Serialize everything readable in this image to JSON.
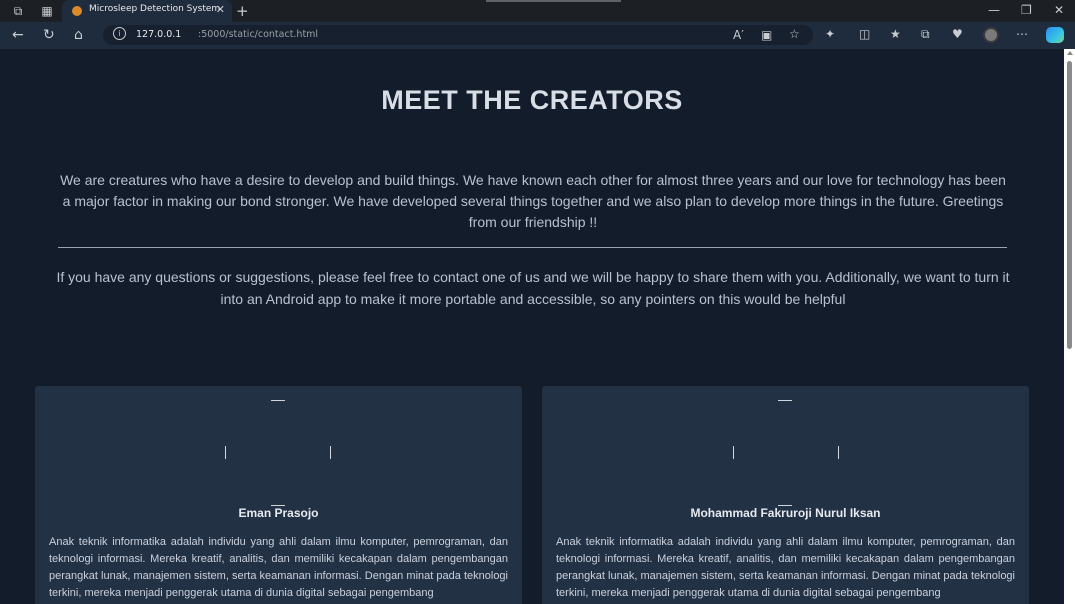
{
  "browser": {
    "tab_title": "Microsleep Detection System",
    "url_host": "127.0.0.1",
    "url_path": ":5000/static/contact.html"
  },
  "page": {
    "title": "MEET THE CREATORS",
    "intro": "We are creatures who have a desire to develop and build things. We have known each other for almost three years and our love for technology has been a major factor in making our bond stronger. We have developed several things together and we also plan to develop more things in the future. Greetings from our friendship !!",
    "contact_text": "If you have any questions or suggestions, please feel free to contact one of us and we will be happy to share them with you. Additionally, we want to turn it into an Android app to make it more portable and accessible, so any pointers on this would be helpful"
  },
  "creators": [
    {
      "name": "Eman Prasojo",
      "bio": "Anak teknik informatika adalah individu yang ahli dalam ilmu komputer, pemrograman, dan teknologi informasi. Mereka kreatif, analitis, dan memiliki kecakapan dalam pengembangan perangkat lunak, manajemen sistem, serta keamanan informasi. Dengan minat pada teknologi terkini, mereka menjadi penggerak utama di dunia digital sebagai pengembang"
    },
    {
      "name": "Mohammad Fakruroji Nurul Iksan",
      "bio": "Anak teknik informatika adalah individu yang ahli dalam ilmu komputer, pemrograman, dan teknologi informasi. Mereka kreatif, analitis, dan memiliki kecakapan dalam pengembangan perangkat lunak, manajemen sistem, serta keamanan informasi. Dengan minat pada teknologi terkini, mereka menjadi penggerak utama di dunia digital sebagai pengembang"
    }
  ],
  "icons": {
    "workspaces": "workspaces-icon",
    "tab_actions": "tab-actions-icon",
    "back": "back-arrow-icon",
    "refresh": "refresh-icon",
    "home": "home-icon",
    "info": "site-info-icon",
    "read_aloud": "read-aloud-icon",
    "immersive": "immersive-reader-icon",
    "favorite": "star-icon",
    "extensions": "extensions-icon",
    "split": "split-screen-icon",
    "favorites": "favorites-icon",
    "collections": "collections-icon",
    "performance": "browser-essentials-icon",
    "more": "more-icon",
    "copilot": "copilot-icon"
  }
}
